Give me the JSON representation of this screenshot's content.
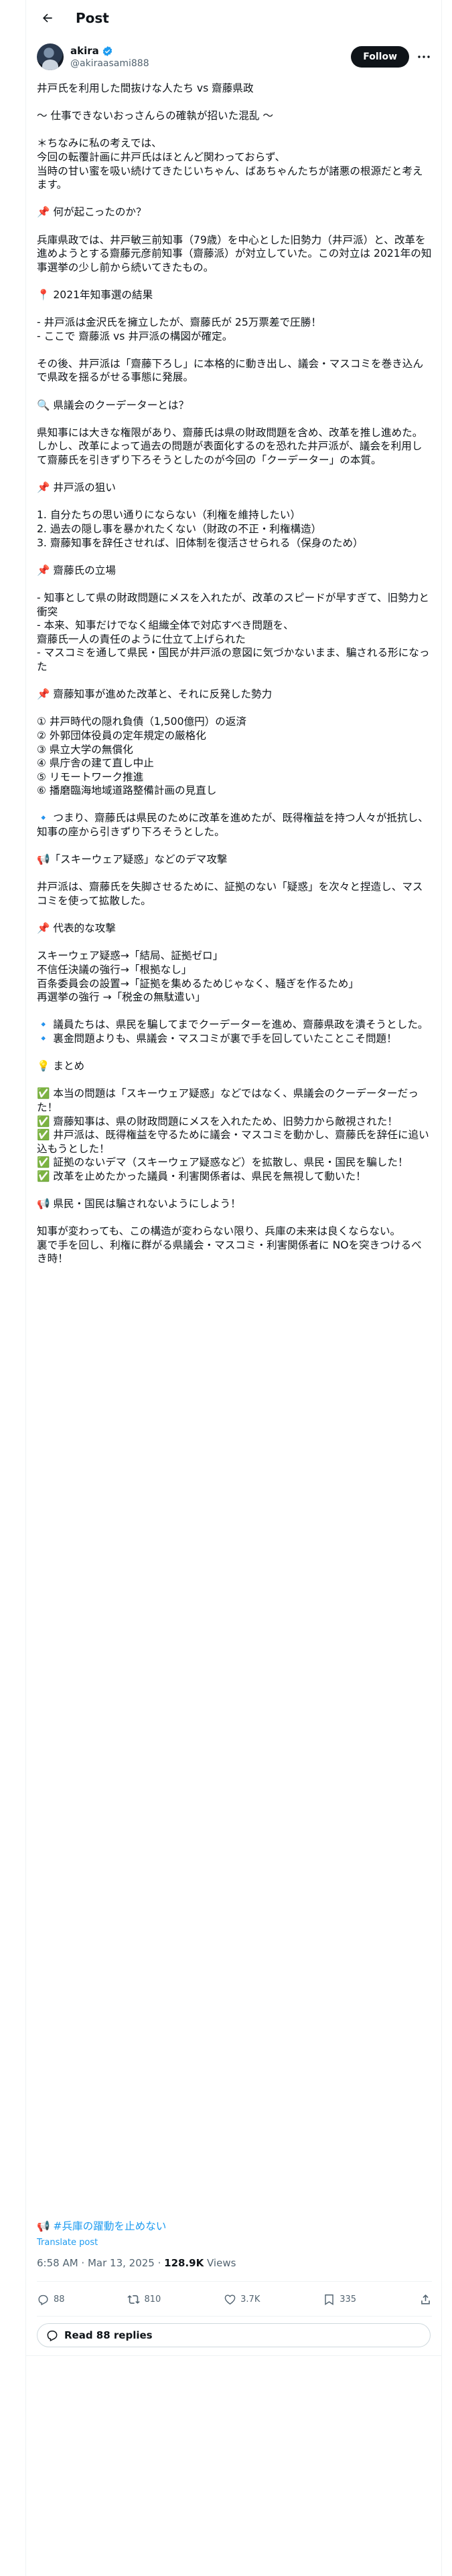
{
  "header": {
    "title": "Post"
  },
  "author": {
    "name": "akira",
    "handle": "@akiraasami888",
    "follow_label": "Follow"
  },
  "post": {
    "lines": [
      "井戸氏を利用した間抜けな人たち vs 齋藤県政",
      "",
      "〜 仕事できないおっさんらの確執が招いた混乱 〜",
      "",
      "＊ちなみに私の考えでは、",
      "今回の転覆計画に井戸氏はほとんど関わっておらず、",
      "当時の甘い蜜を吸い続けてきたじいちゃん、ばあちゃんたちが諸悪の根源だと考えます。",
      "",
      "📌 何が起こったのか？",
      "",
      "兵庫県政では、井戸敏三前知事（79歳）を中心とした旧勢力（井戸派）と、改革を進めようとする齋藤元彦前知事（齋藤派）が対立していた。この対立は 2021年の知事選挙の少し前から続いてきたもの。",
      "",
      "📍 2021年知事選の結果",
      "",
      "- 井戸派は金沢氏を擁立したが、齋藤氏が 25万票差で圧勝！",
      "- ここで 齋藤派 vs 井戸派の構図が確定。",
      "",
      "その後、井戸派は「齋藤下ろし」に本格的に動き出し、議会・マスコミを巻き込んで県政を揺るがせる事態に発展。",
      "",
      "🔍 県議会のクーデーターとは？",
      "",
      "県知事には大きな権限があり、齋藤氏は県の財政問題を含め、改革を推し進めた。しかし、改革によって過去の問題が表面化するのを恐れた井戸派が、議会を利用して齋藤氏を引きずり下ろそうとしたのが今回の「クーデーター」の本質。",
      "",
      "📌 井戸派の狙い",
      "",
      "1. 自分たちの思い通りにならない（利権を維持したい）",
      "2. 過去の隠し事を暴かれたくない（財政の不正・利権構造）",
      "3. 齋藤知事を辞任させれば、旧体制を復活させられる（保身のため）",
      "",
      "📌 齋藤氏の立場",
      "",
      "- 知事として県の財政問題にメスを入れたが、改革のスピードが早すぎて、旧勢力と衝突",
      "- 本来、知事だけでなく組織全体で対応すべき問題を、",
      "齋藤氏一人の責任のように仕立て上げられた",
      "- マスコミを通して県民・国民が井戸派の意図に気づかないまま、騙される形になった",
      "",
      "📌 齋藤知事が進めた改革と、それに反発した勢力",
      "",
      "① 井戸時代の隠れ負債（1,500億円）の返済",
      "② 外郭団体役員の定年規定の厳格化",
      "③ 県立大学の無償化",
      "④ 県庁舎の建て直し中止",
      "⑤ リモートワーク推進",
      "⑥ 播磨臨海地域道路整備計画の見直し",
      "",
      "🔹 つまり、齋藤氏は県民のために改革を進めたが、既得権益を持つ人々が抵抗し、知事の座から引きずり下ろそうとした。",
      "",
      "📢「スキーウェア疑惑」などのデマ攻撃",
      "",
      "井戸派は、齋藤氏を失脚させるために、証拠のない「疑惑」を次々と捏造し、マスコミを使って拡散した。",
      "",
      "📌 代表的な攻撃",
      "",
      "スキーウェア疑惑→「結局、証拠ゼロ」",
      "不信任決議の強行→「根拠なし」",
      "百条委員会の設置→「証拠を集めるためじゃなく、騒ぎを作るため」",
      "再選挙の強行 →「税金の無駄遣い」",
      "",
      "🔹 議員たちは、県民を騙してまでクーデーターを進め、齋藤県政を潰そうとした。",
      "🔹 裏金問題よりも、県議会・マスコミが裏で手を回していたことこそ問題！",
      "",
      "💡 まとめ",
      "",
      "✅ 本当の問題は「スキーウェア疑惑」などではなく、県議会のクーデーターだった！",
      "✅ 齋藤知事は、県の財政問題にメスを入れたため、旧勢力から敵視された！",
      "✅ 井戸派は、既得権益を守るために議会・マスコミを動かし、齋藤氏を辞任に追い込もうとした！",
      "✅ 証拠のないデマ（スキーウェア疑惑など）を拡散し、県民・国民を騙した！",
      "✅ 改革を止めたかった議員・利害関係者は、県民を無視して動いた！",
      "",
      "📢 県民・国民は騙されないようにしよう！",
      "",
      "知事が変わっても、この構造が変わらない限り、兵庫の未来は良くならない。",
      "裏で手を回し、利権に群がる県議会・マスコミ・利害関係者に NOを突きつけるべき時！"
    ],
    "hashtag_prefix": "📢",
    "hashtag": "#兵庫の躍動を止めない",
    "translate": "Translate post",
    "time": "6:58 AM · Mar 13, 2025 · ",
    "views_count": "128.9K",
    "views_label": " Views"
  },
  "actions": {
    "replies": "88",
    "reposts": "810",
    "likes": "3.7K",
    "bookmarks": "335"
  },
  "read_replies_label": "Read 88 replies"
}
